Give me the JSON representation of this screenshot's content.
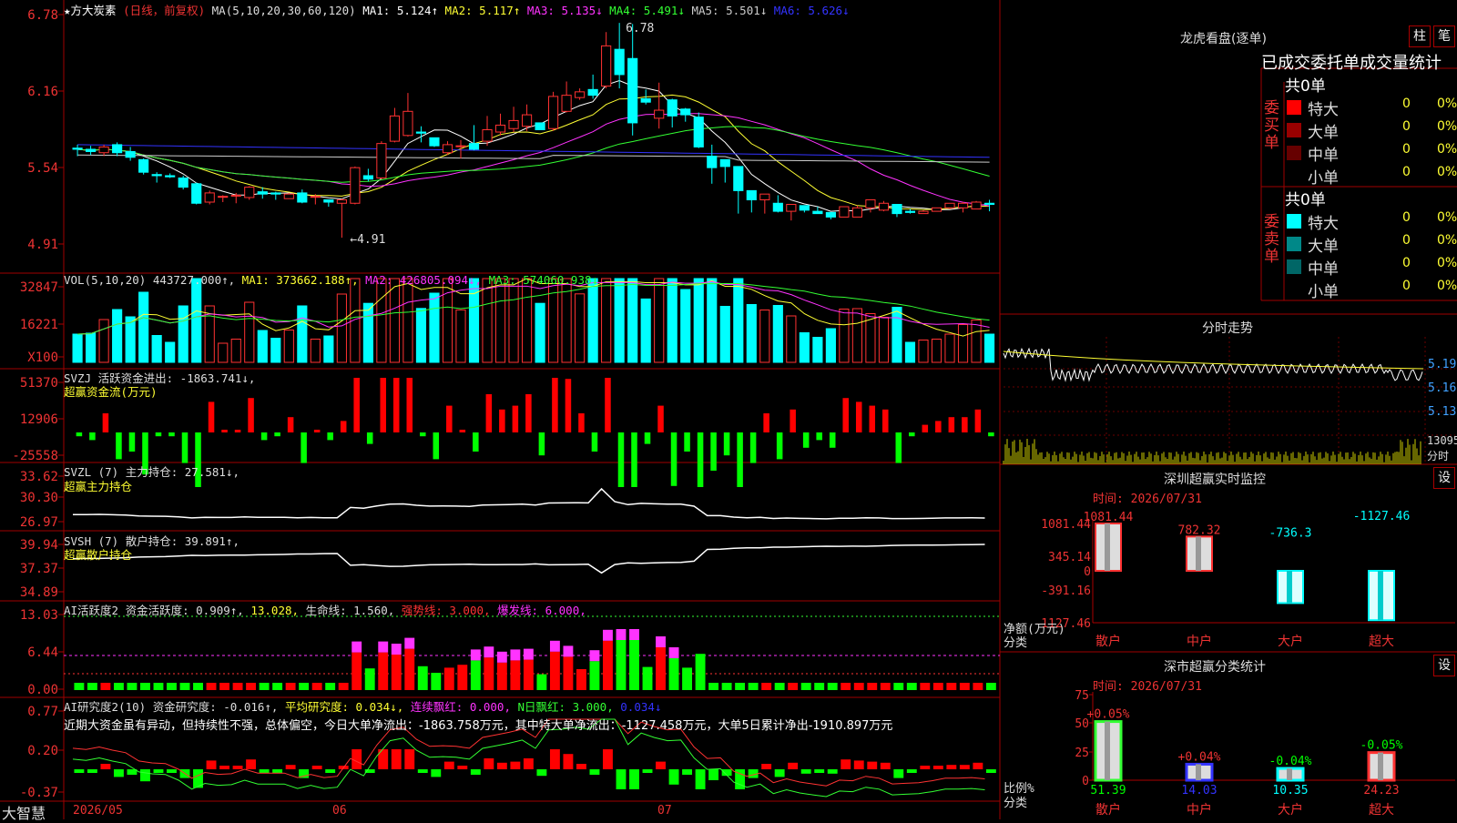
{
  "stock": {
    "name": "★方大炭素",
    "period": "(日线，前复权)"
  },
  "ma": {
    "label": "MA(5,10,20,30,60,120)",
    "items": [
      {
        "text": "MA1: 5.124↑",
        "color": "#ffffff"
      },
      {
        "text": "MA2: 5.117↑",
        "color": "#ffff33"
      },
      {
        "text": "MA3: 5.135↓",
        "color": "#ff33ff"
      },
      {
        "text": "MA4: 5.491↓",
        "color": "#33ff33"
      },
      {
        "text": "MA5: 5.501↓",
        "color": "#cccccc"
      },
      {
        "text": "MA6: 5.626↓",
        "color": "#3333ff"
      }
    ]
  },
  "price_axis": [
    "6.78",
    "6.16",
    "5.54",
    "4.91"
  ],
  "price_marks": {
    "high": "6.78",
    "low": "4.91"
  },
  "vol": {
    "header": [
      {
        "text": "VOL(5,10,20) 443727.000↑,",
        "color": "#dddddd"
      },
      {
        "text": "MA1: 373662.188↑,",
        "color": "#ffff33"
      },
      {
        "text": "MA2: 426805.094↓,",
        "color": "#ff33ff"
      },
      {
        "text": "MA3: 574060.938↓",
        "color": "#33ff33"
      }
    ],
    "axis": [
      "32847",
      "16221",
      "X100"
    ]
  },
  "svzj": {
    "header": "SVZJ  活跃资金进出: -1863.741↓,",
    "sub": "超赢资金流(万元)",
    "axis": [
      "51370",
      "12906",
      "-25558"
    ]
  },
  "svzl": {
    "header": "SVZL (7) 主力持仓: 27.581↓,",
    "sub": "超赢主力持仓",
    "axis": [
      "33.62",
      "30.30",
      "26.97"
    ]
  },
  "svsh": {
    "header": "SVSH (7) 散户持仓: 39.891↑,",
    "sub": "超赢散户持仓",
    "axis": [
      "39.94",
      "37.37",
      "34.89"
    ]
  },
  "ai1": {
    "header": [
      {
        "text": "AI活跃度2 资金活跃度: 0.909↑,",
        "color": "#dddddd"
      },
      {
        "text": "13.028,",
        "color": "#ffff33"
      },
      {
        "text": "生命线: 1.560,",
        "color": "#dddddd"
      },
      {
        "text": "强势线: 3.000,",
        "color": "#ff3333"
      },
      {
        "text": "爆发线: 6.000,",
        "color": "#ff33ff"
      }
    ],
    "axis": [
      "13.03",
      "6.44",
      "0.00"
    ]
  },
  "ai2": {
    "header": [
      {
        "text": "AI研究度2(10) 资金研究度: -0.016↑,",
        "color": "#dddddd"
      },
      {
        "text": "平均研究度: 0.034↓,",
        "color": "#ffff33"
      },
      {
        "text": "连续飘红: 0.000,",
        "color": "#ff33ff"
      },
      {
        "text": "N日飘红: 3.000,",
        "color": "#33ff33"
      },
      {
        "text": "0.034↓",
        "color": "#3333ff"
      }
    ],
    "desc": "近期大资金虽有异动，但持续性不强，总体偏空，今日大单净流出：-1863.758万元，其中特大单净流出：-1127.458万元，大单5日累计净出-1910.897万元",
    "axis": [
      "0.77",
      "0.20",
      "-0.37"
    ]
  },
  "date_axis": [
    "2026/05",
    "06",
    "07"
  ],
  "brand": "大智慧",
  "lhb": {
    "title": "龙虎看盘(逐单)",
    "btn1": "柱",
    "btn2": "笔",
    "sub": "已成交委托单成交量统计",
    "buy": {
      "label": "委买单",
      "total": "共0单",
      "rows": [
        {
          "name": "特大",
          "count": "0",
          "pct": "0%",
          "color": "#ff0000"
        },
        {
          "name": "大单",
          "count": "0",
          "pct": "0%",
          "color": "#990000"
        },
        {
          "name": "中单",
          "count": "0",
          "pct": "0%",
          "color": "#660000"
        },
        {
          "name": "小单",
          "count": "0",
          "pct": "0%",
          "color": "#000000"
        }
      ]
    },
    "sell": {
      "label": "委卖单",
      "total": "共0单",
      "rows": [
        {
          "name": "特大",
          "count": "0",
          "pct": "0%",
          "color": "#00ffff"
        },
        {
          "name": "大单",
          "count": "0",
          "pct": "0%",
          "color": "#008888"
        },
        {
          "name": "中单",
          "count": "0",
          "pct": "0%",
          "color": "#006666"
        },
        {
          "name": "小单",
          "count": "0",
          "pct": "0%",
          "color": "#000000"
        }
      ]
    }
  },
  "intraday": {
    "title": "分时走势",
    "axis": [
      "5.19",
      "5.16",
      "5.13"
    ],
    "vol_label": "13095",
    "time_label": "分时"
  },
  "monitor": {
    "title": "深圳超赢实时监控",
    "btn": "设",
    "time": "时间: 2026/07/31",
    "axis": [
      "1081.44",
      "345.14",
      "0",
      "-391.16",
      "-1127.46"
    ],
    "xlabel": "净额(万元)",
    "xlabel2": "分类",
    "bars": [
      {
        "cat": "散户",
        "value": 1081.44,
        "label": "1081.44"
      },
      {
        "cat": "中户",
        "value": 782.32,
        "label": "782.32"
      },
      {
        "cat": "大户",
        "value": -736.3,
        "label": "-736.3"
      },
      {
        "cat": "超大",
        "value": -1127.46,
        "label": "-1127.46"
      }
    ]
  },
  "stats": {
    "title": "深市超赢分类统计",
    "btn": "设",
    "time": "时间: 2026/07/31",
    "axis": [
      "75",
      "50",
      "25",
      "0"
    ],
    "xlabel": "比例%",
    "xlabel2": "分类",
    "bars": [
      {
        "cat": "散户",
        "value": 51.39,
        "label": "51.39",
        "change": "+0.05%"
      },
      {
        "cat": "中户",
        "value": 14.03,
        "label": "14.03",
        "change": "+0.04%"
      },
      {
        "cat": "大户",
        "value": 10.35,
        "label": "10.35",
        "change": "-0.04%"
      },
      {
        "cat": "超大",
        "value": 24.23,
        "label": "24.23",
        "change": "-0.05%"
      }
    ]
  },
  "chart_data": {
    "type": "candlestick",
    "candles": [
      [
        5.69,
        5.68,
        5.72,
        5.62
      ],
      [
        5.68,
        5.66,
        5.71,
        5.63
      ],
      [
        5.65,
        5.7,
        5.72,
        5.62
      ],
      [
        5.72,
        5.65,
        5.74,
        5.62
      ],
      [
        5.66,
        5.61,
        5.7,
        5.58
      ],
      [
        5.59,
        5.48,
        5.6,
        5.46
      ],
      [
        5.46,
        5.45,
        5.48,
        5.39
      ],
      [
        5.45,
        5.44,
        5.47,
        5.43
      ],
      [
        5.43,
        5.35,
        5.45,
        5.33
      ],
      [
        5.38,
        5.21,
        5.39,
        5.2
      ],
      [
        5.22,
        5.3,
        5.32,
        5.2
      ],
      [
        5.27,
        5.27,
        5.28,
        5.22
      ],
      [
        5.28,
        5.28,
        5.3,
        5.21
      ],
      [
        5.26,
        5.35,
        5.36,
        5.24
      ],
      [
        5.31,
        5.29,
        5.35,
        5.25
      ],
      [
        5.3,
        5.29,
        5.31,
        5.24
      ],
      [
        5.25,
        5.29,
        5.3,
        5.25
      ],
      [
        5.3,
        5.22,
        5.33,
        5.21
      ],
      [
        5.27,
        5.27,
        5.29,
        5.2
      ],
      [
        5.24,
        5.22,
        5.24,
        5.18
      ],
      [
        5.21,
        5.24,
        5.25,
        4.91
      ],
      [
        5.21,
        5.52,
        5.53,
        5.2
      ],
      [
        5.45,
        5.42,
        5.51,
        5.4
      ],
      [
        5.43,
        5.73,
        5.75,
        5.42
      ],
      [
        5.75,
        5.97,
        6.04,
        5.74
      ],
      [
        5.8,
        6.01,
        6.17,
        5.79
      ],
      [
        5.83,
        5.82,
        5.88,
        5.74
      ],
      [
        5.78,
        5.71,
        5.75,
        5.7
      ],
      [
        5.65,
        5.72,
        5.75,
        5.63
      ],
      [
        5.71,
        5.71,
        5.76,
        5.6
      ],
      [
        5.73,
        5.68,
        5.89,
        5.67
      ],
      [
        5.75,
        5.85,
        5.97,
        5.71
      ],
      [
        5.83,
        5.89,
        5.99,
        5.8
      ],
      [
        5.86,
        5.93,
        6.05,
        5.83
      ],
      [
        5.88,
        5.98,
        6.07,
        5.84
      ],
      [
        5.91,
        5.85,
        5.89,
        5.86
      ],
      [
        5.86,
        6.14,
        6.18,
        5.84
      ],
      [
        6.01,
        6.15,
        6.27,
        6.0
      ],
      [
        6.13,
        6.18,
        6.21,
        6.11
      ],
      [
        6.2,
        6.15,
        6.33,
        6.12
      ],
      [
        6.23,
        6.58,
        6.7,
        6.21
      ],
      [
        6.55,
        6.33,
        6.78,
        6.21
      ],
      [
        6.47,
        5.91,
        6.77,
        5.8
      ],
      [
        6.12,
        6.09,
        6.2,
        6.07
      ],
      [
        5.95,
        6.02,
        6.26,
        5.86
      ],
      [
        6.11,
        5.97,
        6.12,
        5.87
      ],
      [
        6.03,
        5.98,
        6.04,
        5.92
      ],
      [
        5.96,
        5.7,
        6.0,
        5.69
      ],
      [
        5.62,
        5.52,
        5.72,
        5.38
      ],
      [
        5.59,
        5.53,
        5.56,
        5.39
      ],
      [
        5.53,
        5.32,
        5.39,
        5.12
      ],
      [
        5.32,
        5.24,
        5.26,
        5.13
      ],
      [
        5.24,
        5.29,
        5.29,
        5.12
      ],
      [
        5.21,
        5.14,
        5.28,
        5.13
      ],
      [
        5.14,
        5.2,
        5.16,
        5.06
      ],
      [
        5.19,
        5.15,
        5.16,
        5.13
      ],
      [
        5.14,
        5.12,
        5.18,
        5.13
      ],
      [
        5.13,
        5.09,
        5.13,
        5.07
      ],
      [
        5.09,
        5.18,
        5.16,
        5.09
      ],
      [
        5.09,
        5.17,
        5.19,
        5.09
      ],
      [
        5.17,
        5.24,
        5.22,
        5.13
      ],
      [
        5.15,
        5.21,
        5.23,
        5.14
      ],
      [
        5.2,
        5.12,
        5.2,
        5.09
      ],
      [
        5.14,
        5.13,
        5.16,
        5.12
      ],
      [
        5.12,
        5.14,
        5.15,
        5.12
      ],
      [
        5.14,
        5.17,
        5.16,
        5.15
      ],
      [
        5.17,
        5.21,
        5.18,
        5.16
      ],
      [
        5.17,
        5.21,
        5.22,
        5.13
      ],
      [
        5.16,
        5.22,
        5.23,
        5.16
      ],
      [
        5.21,
        5.2,
        5.24,
        5.14
      ]
    ],
    "ylim": [
      4.91,
      6.78
    ]
  }
}
